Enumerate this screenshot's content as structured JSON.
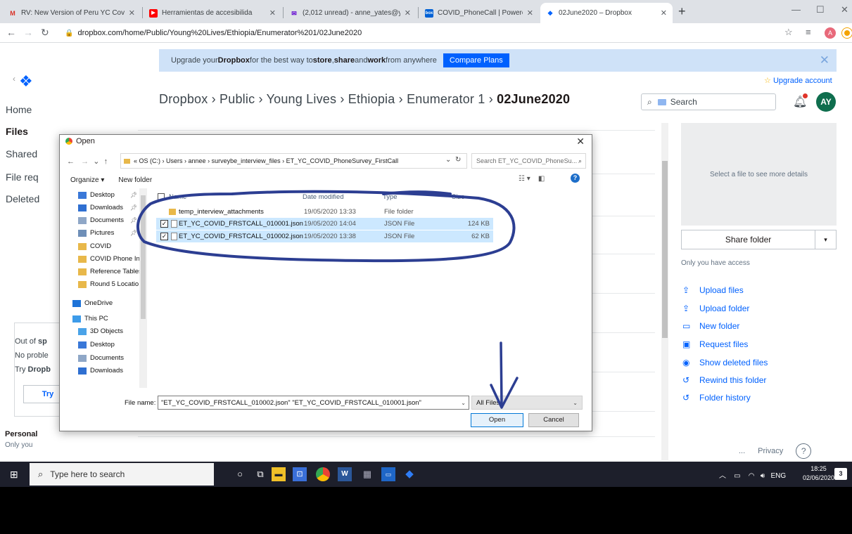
{
  "browser": {
    "tabs": [
      {
        "title": "RV: New Version of Peru YC Covi",
        "icon": "gmail-icon",
        "icon_color": "#d93025"
      },
      {
        "title": "Herramientas de accesibilida",
        "icon": "youtube-icon",
        "icon_color": "#ff0000"
      },
      {
        "title": "(2,012 unread) - anne_yates@yal",
        "icon": "mail-icon",
        "icon_color": "#5f01d1"
      },
      {
        "title": "COVID_PhoneCall | Powered by B",
        "icon": "box-icon",
        "icon_color": "#0061d5"
      },
      {
        "title": "02June2020 – Dropbox",
        "icon": "dropbox-icon",
        "icon_color": "#0061fe"
      }
    ],
    "url": "dropbox.com/home/Public/Young%20Lives/Ethiopia/Enumerator%201/02June2020",
    "profile_initial": "A"
  },
  "dropbox": {
    "banner": {
      "text_pre": "Upgrade your ",
      "brand": "Dropbox",
      "text_mid": " for the best way to ",
      "b1": "store",
      "sep1": ", ",
      "b2": "share",
      "sep2": " and ",
      "b3": "work",
      "text_post": " from anywhere",
      "button": "Compare Plans"
    },
    "upgrade_link": "Upgrade account",
    "nav": [
      "Home",
      "Files",
      "Shared",
      "File req",
      "Deleted"
    ],
    "breadcrumb": [
      "Dropbox",
      "Public",
      "Young Lives",
      "Ethiopia",
      "Enumerator 1",
      "02June2020"
    ],
    "search_placeholder": "Search",
    "avatar": "AY",
    "details_text": "Select a file to see more details",
    "share_button": "Share folder",
    "access_text": "Only you have access",
    "actions": [
      "Upload files",
      "Upload folder",
      "New folder",
      "Request files",
      "Show deleted files",
      "Rewind this folder",
      "Folder history"
    ],
    "out_of_space": {
      "line1_pre": "Out of ",
      "line1_bold": "sp",
      "line2": "No proble",
      "line3_pre": "Try ",
      "line3_bold": "Dropb",
      "button": "Try"
    },
    "personal": "Personal",
    "only_you": "Only you",
    "privacy": "Privacy",
    "more": "..."
  },
  "dialog": {
    "title": "Open",
    "path": [
      "« OS (C:)",
      "Users",
      "annee",
      "surveybe_interview_files",
      "ET_YC_COVID_PhoneSurvey_FirstCall"
    ],
    "search_placeholder": "Search ET_YC_COVID_PhoneSu...",
    "organize": "Organize ▾",
    "new_folder": "New folder",
    "nav_items": [
      {
        "label": "Desktop",
        "icon": "desktop-icon",
        "color": "#3a78d8",
        "pinned": true
      },
      {
        "label": "Downloads",
        "icon": "downloads-icon",
        "color": "#2f6fd1",
        "pinned": true
      },
      {
        "label": "Documents",
        "icon": "documents-icon",
        "color": "#8fa7c7",
        "pinned": true
      },
      {
        "label": "Pictures",
        "icon": "pictures-icon",
        "color": "#6f8fb8",
        "pinned": true
      },
      {
        "label": "COVID",
        "icon": "folder-icon",
        "color": "#e8b84a",
        "pinned": false
      },
      {
        "label": "COVID Phone Int",
        "icon": "folder-icon",
        "color": "#e8b84a",
        "pinned": false
      },
      {
        "label": "Reference Tables",
        "icon": "folder-icon",
        "color": "#e8b84a",
        "pinned": false
      },
      {
        "label": "Round 5 Locatio",
        "icon": "folder-icon",
        "color": "#e8b84a",
        "pinned": false
      },
      {
        "label": "OneDrive",
        "icon": "onedrive-icon",
        "color": "#1e73d8",
        "pinned": false
      },
      {
        "label": "This PC",
        "icon": "this-pc-icon",
        "color": "#3d9be9",
        "pinned": false
      },
      {
        "label": "3D Objects",
        "icon": "3d-objects-icon",
        "color": "#4aa3e8",
        "pinned": false
      },
      {
        "label": "Desktop",
        "icon": "desktop-icon",
        "color": "#3a78d8",
        "pinned": false
      },
      {
        "label": "Documents",
        "icon": "documents-icon",
        "color": "#8fa7c7",
        "pinned": false
      },
      {
        "label": "Downloads",
        "icon": "downloads-icon",
        "color": "#2f6fd1",
        "pinned": false
      }
    ],
    "columns": [
      "Name",
      "Date modified",
      "Type",
      "Size"
    ],
    "files": [
      {
        "name": "temp_interview_attachments",
        "date": "19/05/2020 13:33",
        "type": "File folder",
        "size": "",
        "selected": false,
        "folder": true
      },
      {
        "name": "ET_YC_COVID_FRSTCALL_010001.json",
        "date": "19/05/2020 14:04",
        "type": "JSON File",
        "size": "124 KB",
        "selected": true,
        "folder": false
      },
      {
        "name": "ET_YC_COVID_FRSTCALL_010002.json",
        "date": "19/05/2020 13:38",
        "type": "JSON File",
        "size": "62 KB",
        "selected": true,
        "folder": false
      }
    ],
    "filename_label": "File name:",
    "filename_value": "\"ET_YC_COVID_FRSTCALL_010002.json\" \"ET_YC_COVID_FRSTCALL_010001.json\"",
    "filter": "All Files",
    "open": "Open",
    "cancel": "Cancel"
  },
  "taskbar": {
    "search_placeholder": "Type here to search",
    "language": "ENG",
    "time": "18:25",
    "date": "02/06/2020",
    "notifications": "3"
  }
}
